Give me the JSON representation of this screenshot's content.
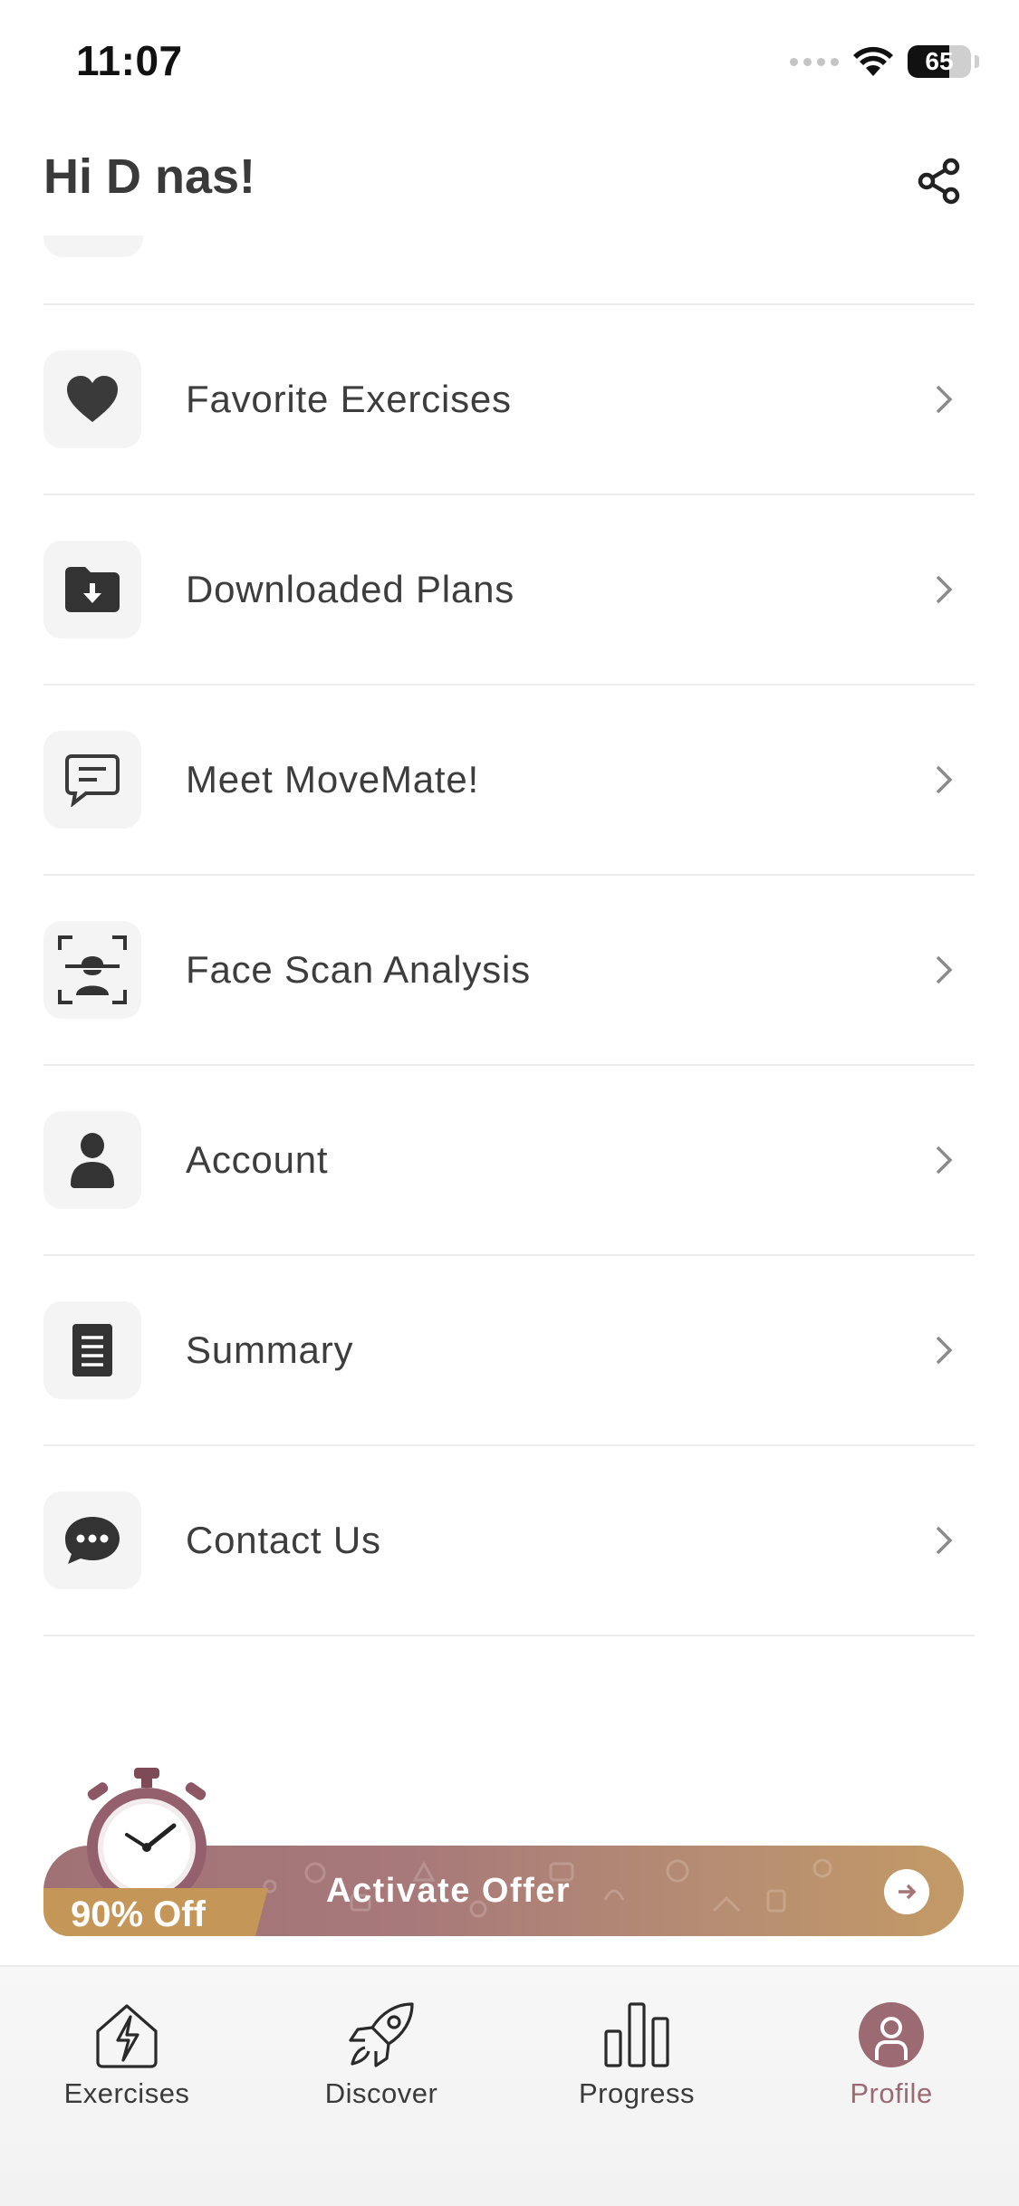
{
  "status_bar": {
    "time": "11:07",
    "battery_percent": "65",
    "battery_level": 0.65
  },
  "header": {
    "greeting": "Hi D nas!"
  },
  "menu": {
    "items": [
      {
        "label": "Favorite Exercises",
        "icon": "heart-icon"
      },
      {
        "label": "Downloaded Plans",
        "icon": "folder-download-icon"
      },
      {
        "label": "Meet MoveMate!",
        "icon": "chat-bubble-icon"
      },
      {
        "label": "Face Scan Analysis",
        "icon": "face-scan-icon"
      },
      {
        "label": "Account",
        "icon": "person-icon"
      },
      {
        "label": "Summary",
        "icon": "document-icon"
      },
      {
        "label": "Contact Us",
        "icon": "message-dots-icon"
      }
    ]
  },
  "offer": {
    "discount": "90% Off",
    "cta": "Activate Offer"
  },
  "tabs": [
    {
      "label": "Exercises",
      "icon": "house-bolt-icon",
      "active": false
    },
    {
      "label": "Discover",
      "icon": "rocket-icon",
      "active": false
    },
    {
      "label": "Progress",
      "icon": "bar-chart-icon",
      "active": false
    },
    {
      "label": "Profile",
      "icon": "profile-icon",
      "active": true
    }
  ],
  "colors": {
    "accent": "#9c6a73",
    "offer_start": "#a07276",
    "offer_end": "#c39a66",
    "discount": "#c49758"
  }
}
